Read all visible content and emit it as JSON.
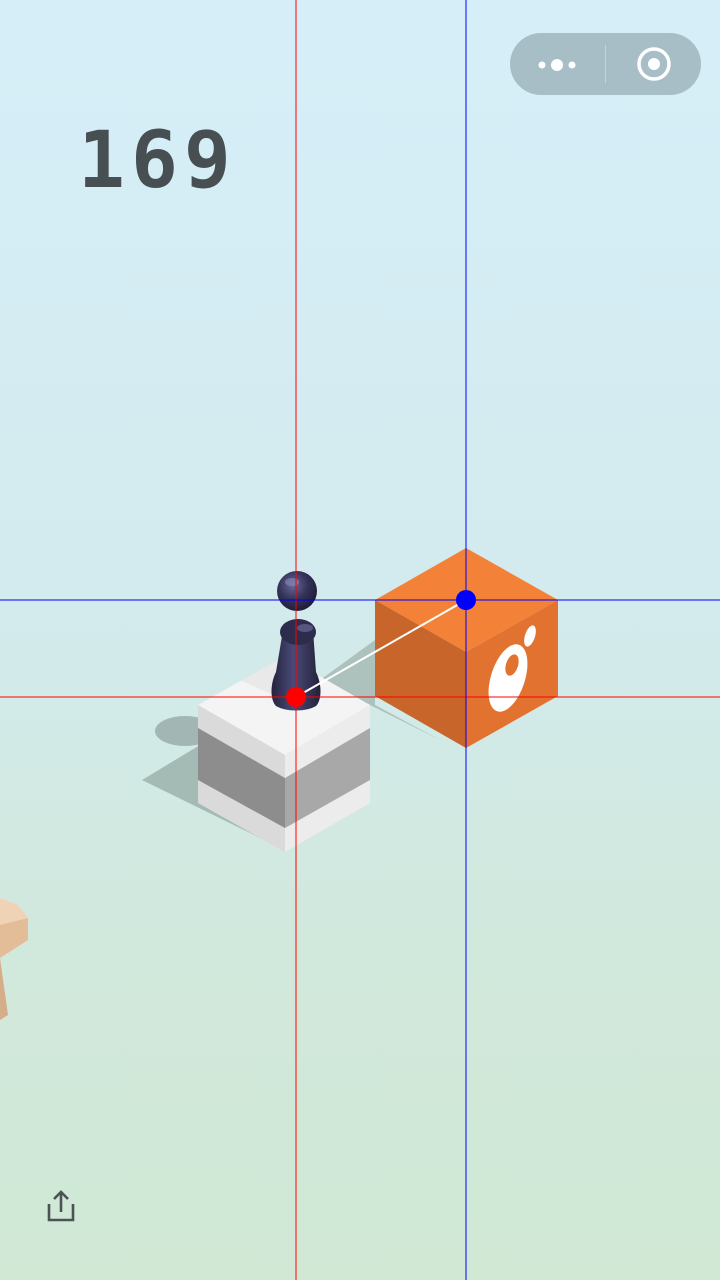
{
  "game": {
    "score": "169"
  },
  "capsule": {
    "more_icon": "more-dots-icon",
    "close_icon": "close-target-icon"
  },
  "share": {
    "icon": "share-icon"
  },
  "colors": {
    "score": "#474f52",
    "target_block": "#f07d38",
    "current_block": "#f1f1f1",
    "player": "#2f2e4a",
    "wood_block": "#e8c7a6",
    "crosshair_red": "#ff0000",
    "crosshair_blue": "#0000ff"
  },
  "overlay": {
    "player_marker": "red-dot",
    "target_marker": "blue-dot"
  }
}
